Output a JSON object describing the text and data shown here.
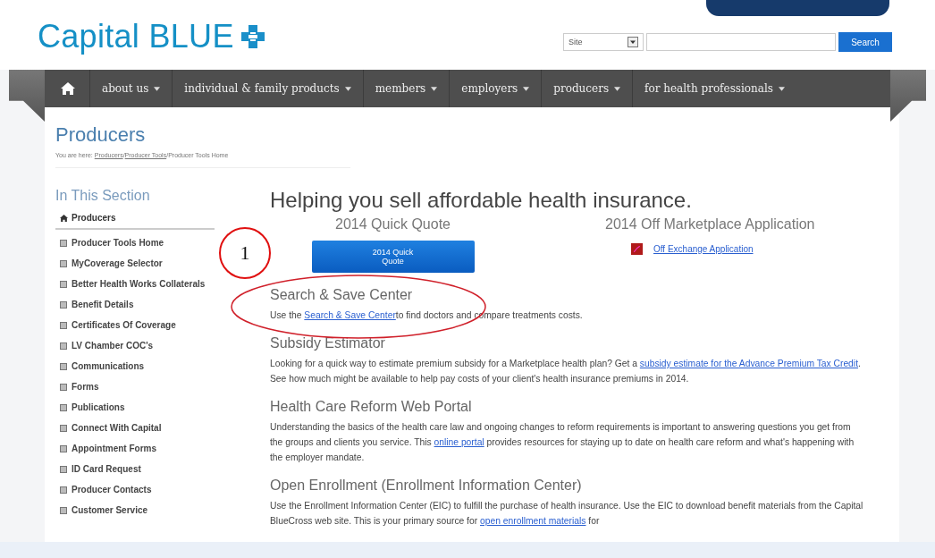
{
  "header": {
    "logo": "Capital BLUE",
    "search": {
      "scope": "Site",
      "button": "Search"
    }
  },
  "nav": [
    "about us",
    "individual & family products",
    "members",
    "employers",
    "producers",
    "for health professionals"
  ],
  "page": {
    "title": "Producers",
    "breadcrumb": {
      "prefix": "You are here: ",
      "links": [
        "Producers",
        "Producer Tools"
      ],
      "separator": "/",
      "current": "Producer Tools Home"
    }
  },
  "sidebar": {
    "title": "In This Section",
    "home": "Producers",
    "items": [
      "Producer Tools Home",
      "MyCoverage Selector",
      "Better Health Works Collaterals",
      "Benefit Details",
      "Certificates Of Coverage",
      "LV Chamber COC's",
      "Communications",
      "Forms",
      "Publications",
      "Connect With Capital",
      "Appointment Forms",
      "ID Card Request",
      "Producer Contacts",
      "Customer Service"
    ]
  },
  "main": {
    "headline": "Helping you sell affordable health insurance.",
    "quick_quote": {
      "heading": "2014 Quick Quote",
      "button": "2014 Quick Quote"
    },
    "application": {
      "heading": "2014 Off Marketplace Application",
      "link": "Off Exchange Application"
    },
    "sections": [
      {
        "heading": "Search & Save Center",
        "before": "Use the ",
        "link": "Search & Save Center",
        "after": "to find doctors and compare treatments costs."
      },
      {
        "heading": "Subsidy Estimator",
        "before": "Looking for a quick way to estimate premium subsidy for a Marketplace health plan? Get a ",
        "link": "subsidy estimate for the Advance Premium Tax Credit",
        "after": ". See how much might be available to help pay costs of your client's health insurance premiums in 2014."
      },
      {
        "heading": "Health Care Reform Web Portal",
        "before": "Understanding the basics of the health care law and ongoing changes to reform requirements is important to answering questions you get from the groups and clients you service. This ",
        "link": "online portal",
        "after": " provides resources for staying up to date on health care reform and what's happening with the employer mandate."
      },
      {
        "heading": "Open Enrollment (Enrollment Information Center)",
        "before": "Use the Enrollment Information Center (EIC) to fulfill the purchase of health insurance. Use the EIC to download benefit materials from the Capital BlueCross web site. This is your primary source for ",
        "link": "open enrollment materials",
        "after": " for"
      }
    ]
  },
  "annotation": {
    "number": "1"
  }
}
